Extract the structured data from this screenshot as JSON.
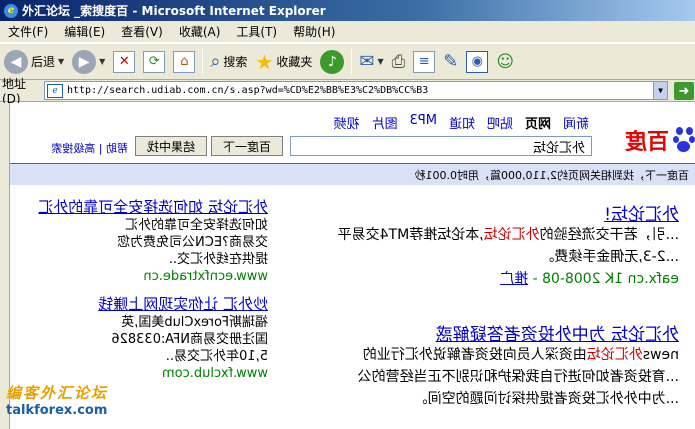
{
  "window": {
    "title": "外汇论坛 _索搜度百 - Microsoft Internet Explorer"
  },
  "menu": [
    "文件(F)",
    "编辑(E)",
    "查看(V)",
    "收藏(A)",
    "工具(T)",
    "帮助(H)"
  ],
  "toolbar": {
    "back_label": "后退",
    "search_label": "搜索",
    "favorites_label": "收藏夹"
  },
  "address": {
    "label": "地址(D)",
    "url": "http://search.udiab.com.cn/s.asp?wd=%CD%E2%BB%E3%C2%DB%CC%B3"
  },
  "baidu": {
    "nav": [
      "新闻",
      "网页",
      "贴吧",
      "知道",
      "MP3",
      "图片",
      "视频"
    ],
    "logo": "百度",
    "query": "外汇论坛",
    "button_search": "百度一下",
    "button_within": "结果中找",
    "help_links": "帮助 | 高级搜索",
    "stats": "百度一下，找到相关网页约2,110,000篇，用时0.001秒"
  },
  "results": [
    {
      "title": "外汇论坛!",
      "lines": [
        [
          "...引，若干交流经验的",
          "外汇论坛",
          ",本论坛推荐MT4交易平"
        ],
        [
          "...2-3,无佣金手续费。"
        ],
        [
          "eafx.cn 1K 2008-08 - ",
          "推广"
        ]
      ]
    },
    {
      "title": "外汇论坛 为中外投资者答疑解惑",
      "lines": [
        [
          "news",
          "外汇论坛",
          "由资深人员向投资者解说外汇行业的"
        ],
        [
          "...育投资者如何进行自我保护和识别不正当经营的公"
        ],
        [
          "...为中外外汇投资者提供探讨问题的空间。"
        ]
      ]
    }
  ],
  "ads": [
    {
      "title": "外汇论坛 如何选择安全可靠的外汇",
      "lines": [
        "如何选择安全可靠的外汇",
        "交易商?ECN公司免费为您",
        "提供在线外汇交..",
        "www.ecnfxtrade.cn"
      ]
    },
    {
      "title": "炒外汇 让你实现网上赚钱",
      "lines": [
        "福瑞斯ForexClub美国,英",
        "国注册交易商NFA:033826",
        "5,10年外汇交易..",
        "www.fxclub.com"
      ]
    }
  ],
  "watermark": {
    "line1": "编客外汇论坛",
    "line2": "talkforex.com"
  },
  "colors": {
    "link": "#0000cc",
    "highlight": "#cc0000",
    "url_green": "#008000",
    "baidu_red": "#e10602",
    "baidu_blue": "#2932e1"
  }
}
